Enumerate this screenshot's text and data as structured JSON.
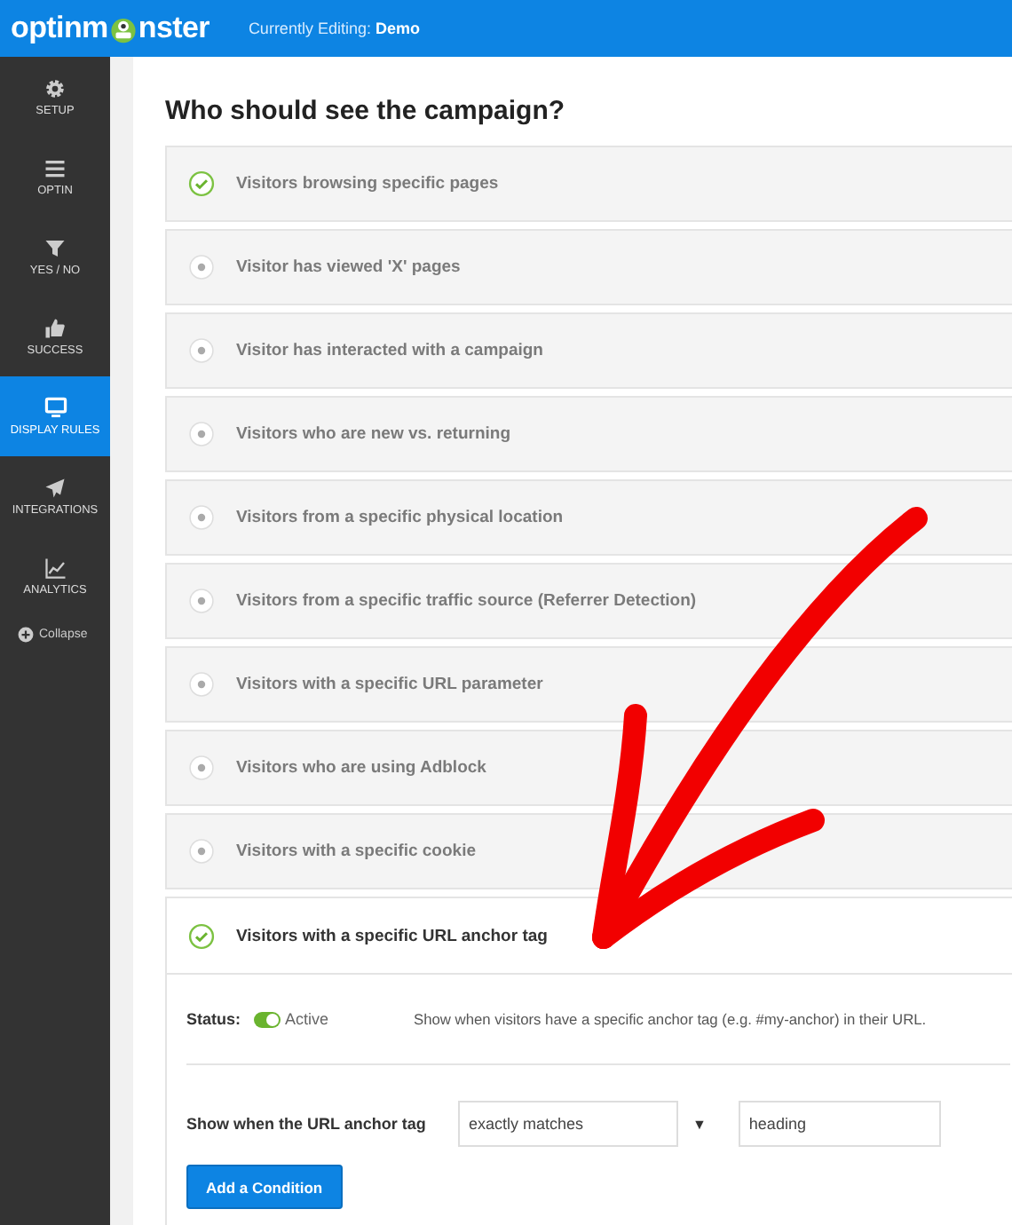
{
  "header": {
    "logo_start": "optinm",
    "logo_end": "nster",
    "editing_label": "Currently Editing:",
    "campaign": "Demo"
  },
  "sidebar": {
    "items": [
      {
        "label": "SETUP",
        "selected": false
      },
      {
        "label": "OPTIN",
        "selected": false
      },
      {
        "label": "YES / NO",
        "selected": false
      },
      {
        "label": "SUCCESS",
        "selected": false
      },
      {
        "label": "DISPLAY RULES",
        "selected": true
      },
      {
        "label": "INTEGRATIONS",
        "selected": false
      },
      {
        "label": "ANALYTICS",
        "selected": false
      }
    ],
    "collapse": "Collapse"
  },
  "heading": "Who should see the campaign?",
  "rules": [
    {
      "label": "Visitors browsing specific pages",
      "checked": true,
      "expanded": false
    },
    {
      "label": "Visitor has viewed 'X' pages",
      "checked": false,
      "expanded": false
    },
    {
      "label": "Visitor has interacted with a campaign",
      "checked": false,
      "expanded": false
    },
    {
      "label": "Visitors who are new vs. returning",
      "checked": false,
      "expanded": false
    },
    {
      "label": "Visitors from a specific physical location",
      "checked": false,
      "expanded": false
    },
    {
      "label": "Visitors from a specific traffic source (Referrer Detection)",
      "checked": false,
      "expanded": false
    },
    {
      "label": "Visitors with a specific URL parameter",
      "checked": false,
      "expanded": false
    },
    {
      "label": "Visitors who are using Adblock",
      "checked": false,
      "expanded": false
    },
    {
      "label": "Visitors with a specific cookie",
      "checked": false,
      "expanded": false
    },
    {
      "label": "Visitors with a specific URL anchor tag",
      "checked": true,
      "expanded": true
    }
  ],
  "detail": {
    "status_label": "Status:",
    "status_on": true,
    "status_text": "Active",
    "description": "Show when visitors have a specific anchor tag (e.g. #my-anchor) in their URL.",
    "condition_label": "Show when the URL anchor tag",
    "operator": "exactly matches",
    "arrow": "▼",
    "value": "heading",
    "add_button": "Add a Condition"
  }
}
